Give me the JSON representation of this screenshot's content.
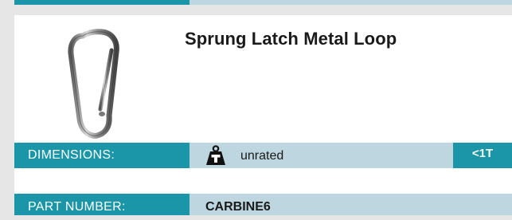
{
  "product": {
    "title": "Sprung Latch Metal Loop",
    "image_icon": "carabiner-icon"
  },
  "specs": {
    "dimensions": {
      "label": "DIMENSIONS:",
      "icon": "weight-icon",
      "value": "unrated",
      "badge": "<1T"
    },
    "part_number": {
      "label": "PART NUMBER:",
      "value": "CARBINE6"
    }
  },
  "colors": {
    "accent": "#1b95a8",
    "value_bg": "#bdd6df",
    "page_bg": "#e6e6e6"
  }
}
